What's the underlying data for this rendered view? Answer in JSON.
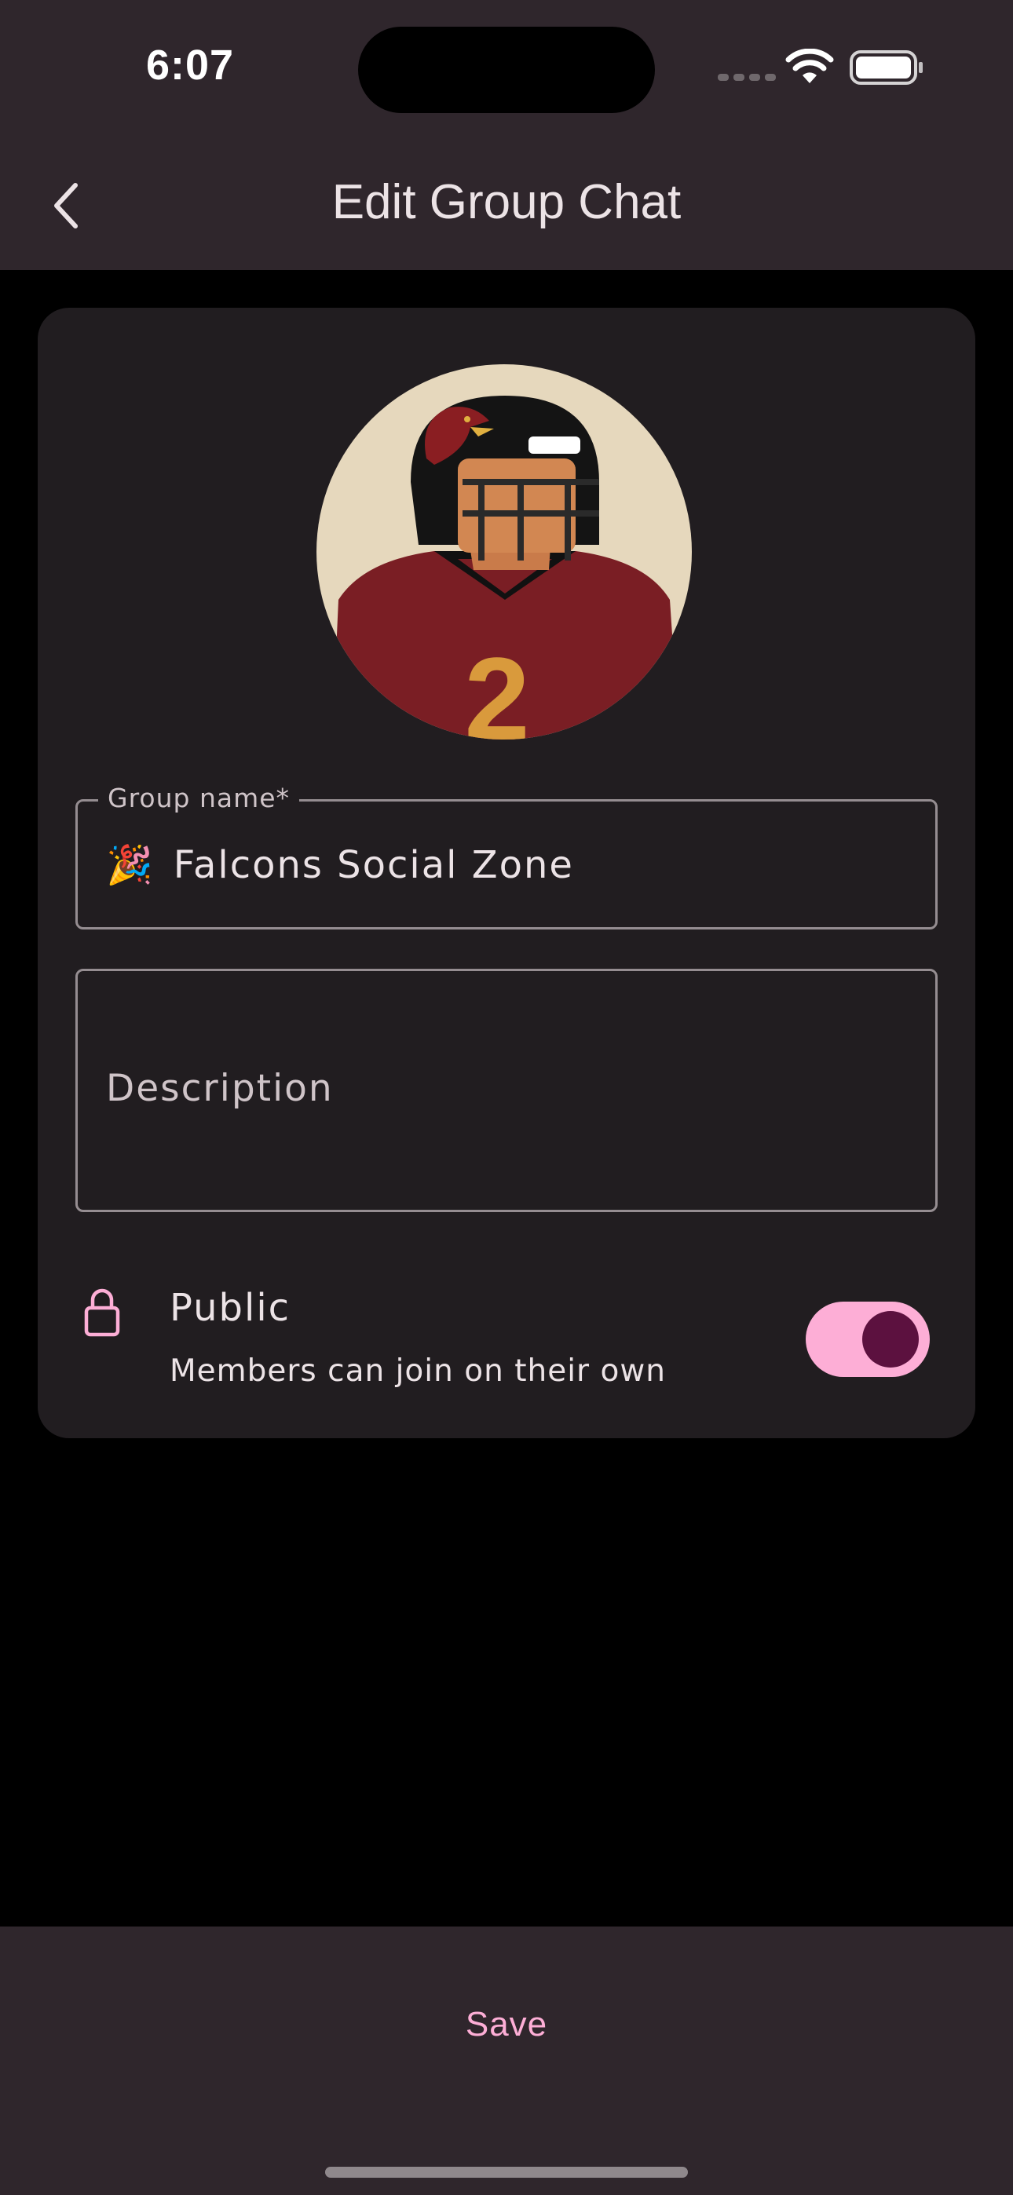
{
  "status_bar": {
    "time": "6:07"
  },
  "header": {
    "title": "Edit Group Chat",
    "back_icon": "chevron-left-icon"
  },
  "form": {
    "group_name": {
      "label": "Group name*",
      "emoji": "🎉",
      "value": "Falcons Social Zone"
    },
    "description": {
      "placeholder": "Description",
      "value": ""
    },
    "visibility": {
      "icon": "lock-icon",
      "title": "Public",
      "subtitle": "Members can join on their own",
      "enabled": true
    }
  },
  "footer": {
    "save_label": "Save"
  },
  "colors": {
    "bar_background": "#2f262c",
    "card_background": "#211d20",
    "accent": "#fdaed6",
    "toggle_knob": "#5c113f"
  }
}
